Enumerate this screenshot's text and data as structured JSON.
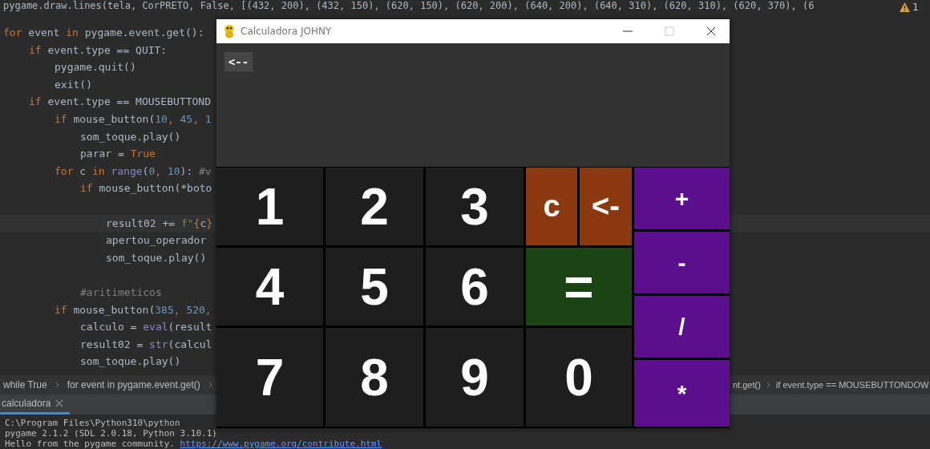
{
  "editor": {
    "top_line": "pygame.draw.lines(tela, CorPRETO, False, [(432, 200), (432, 150), (620, 150), (620, 200), (640, 200), (640, 310), (620, 310), (620, 370), (6",
    "warning_count": "1",
    "lines": [
      {
        "tokens": [
          {
            "text": "for ",
            "kind": "kw"
          },
          {
            "text": "event ",
            "kind": "plain"
          },
          {
            "text": "in ",
            "kind": "kw"
          },
          {
            "text": "pygame.event.get():",
            "kind": "plain"
          }
        ],
        "children": [
          {
            "tokens": [
              {
                "text": "if ",
                "kind": "kw"
              },
              {
                "text": "event.type == QUIT:",
                "kind": "plain"
              }
            ],
            "children": [
              {
                "tokens": [
                  {
                    "text": "pygame.quit()",
                    "kind": "plain"
                  }
                ]
              },
              {
                "tokens": [
                  {
                    "text": "exit()",
                    "kind": "plain"
                  }
                ]
              }
            ]
          },
          {
            "tokens": [
              {
                "text": "if ",
                "kind": "kw"
              },
              {
                "text": "event.type == MOUSEBUTTOND",
                "kind": "plain"
              }
            ],
            "children": [
              {
                "tokens": [
                  {
                    "text": "if ",
                    "kind": "kw"
                  },
                  {
                    "text": "mouse_button(",
                    "kind": "plain"
                  },
                  {
                    "text": "10",
                    "kind": "num"
                  },
                  {
                    "text": ", ",
                    "kind": "kw"
                  },
                  {
                    "text": "45",
                    "kind": "num"
                  },
                  {
                    "text": ", ",
                    "kind": "kw"
                  },
                  {
                    "text": "1",
                    "kind": "num"
                  }
                ],
                "children": [
                  {
                    "tokens": [
                      {
                        "text": "som_toque.play()",
                        "kind": "plain"
                      }
                    ]
                  },
                  {
                    "tokens": [
                      {
                        "text": "parar = ",
                        "kind": "plain"
                      },
                      {
                        "text": "True",
                        "kind": "kw"
                      }
                    ]
                  }
                ]
              },
              {
                "tokens": [
                  {
                    "text": "for ",
                    "kind": "kw"
                  },
                  {
                    "text": "c ",
                    "kind": "plain"
                  },
                  {
                    "text": "in ",
                    "kind": "kw"
                  },
                  {
                    "text": "range",
                    "kind": "builtin"
                  },
                  {
                    "text": "(",
                    "kind": "plain"
                  },
                  {
                    "text": "0",
                    "kind": "num"
                  },
                  {
                    "text": ", ",
                    "kind": "kw"
                  },
                  {
                    "text": "10",
                    "kind": "num"
                  },
                  {
                    "text": "): ",
                    "kind": "plain"
                  },
                  {
                    "text": "#v",
                    "kind": "comment"
                  }
                ],
                "children": [
                  {
                    "tokens": [
                      {
                        "text": "if ",
                        "kind": "kw"
                      },
                      {
                        "text": "mouse_button(*boto",
                        "kind": "plain"
                      }
                    ],
                    "children": [
                      {
                        "blank_before": true,
                        "highlighted": true,
                        "tokens": [
                          {
                            "text": "result02 += ",
                            "kind": "plain"
                          },
                          {
                            "text": "f\"",
                            "kind": "str"
                          },
                          {
                            "text": "{",
                            "kind": "kw"
                          },
                          {
                            "text": "c",
                            "kind": "plain"
                          },
                          {
                            "text": "}",
                            "kind": "kw"
                          }
                        ]
                      },
                      {
                        "tokens": [
                          {
                            "text": "apertou_operador",
                            "kind": "plain"
                          }
                        ]
                      },
                      {
                        "tokens": [
                          {
                            "text": "som_toque.play()",
                            "kind": "plain"
                          }
                        ]
                      }
                    ]
                  },
                  {
                    "blank_before": true,
                    "tokens": [
                      {
                        "text": "#aritimeticos",
                        "kind": "comment"
                      }
                    ]
                  }
                ]
              },
              {
                "tokens": [
                  {
                    "text": "if ",
                    "kind": "kw"
                  },
                  {
                    "text": "mouse_button(",
                    "kind": "plain"
                  },
                  {
                    "text": "385",
                    "kind": "num"
                  },
                  {
                    "text": ", ",
                    "kind": "kw"
                  },
                  {
                    "text": "520",
                    "kind": "num"
                  },
                  {
                    "text": ",",
                    "kind": "kw"
                  }
                ],
                "children": [
                  {
                    "tokens": [
                      {
                        "text": "calculo = ",
                        "kind": "plain"
                      },
                      {
                        "text": "eval",
                        "kind": "builtin"
                      },
                      {
                        "text": "(result",
                        "kind": "plain"
                      }
                    ]
                  },
                  {
                    "tokens": [
                      {
                        "text": "result02 = ",
                        "kind": "plain"
                      },
                      {
                        "text": "str",
                        "kind": "builtin"
                      },
                      {
                        "text": "(calcul",
                        "kind": "plain"
                      }
                    ]
                  },
                  {
                    "tokens": [
                      {
                        "text": "som_toque.play()",
                        "kind": "plain"
                      }
                    ]
                  }
                ]
              }
            ]
          }
        ]
      }
    ]
  },
  "breadcrumbs_left": [
    "while True",
    "for event in pygame.event.get()"
  ],
  "breadcrumbs_right": [
    "nt.get()",
    "if event.type == MOUSEBUTTONDOW"
  ],
  "run_tab": {
    "label": "calculadora"
  },
  "terminal": {
    "lines": [
      "C:\\Program Files\\Python310\\python",
      "pygame 2.1.2 (SDL 2.0.18, Python 3.10.1)"
    ],
    "last_text": "Hello from the pygame community.",
    "last_link": "https://www.pygame.org/contribute.html"
  },
  "calculator": {
    "title": "Calculadora JOHNY",
    "back_label": "<--",
    "keys": [
      {
        "label": "1",
        "kind": "digit",
        "wide": false
      },
      {
        "label": "2",
        "kind": "digit",
        "wide": false
      },
      {
        "label": "3",
        "kind": "digit",
        "wide": false
      },
      {
        "label": "c",
        "kind": "clear",
        "wide": false
      },
      {
        "label": "<-",
        "kind": "clear",
        "wide": false
      },
      {
        "label": "4",
        "kind": "digit",
        "wide": false
      },
      {
        "label": "5",
        "kind": "digit",
        "wide": false
      },
      {
        "label": "6",
        "kind": "digit",
        "wide": false
      },
      {
        "label": "=",
        "kind": "equals",
        "wide": true
      },
      {
        "label": "7",
        "kind": "digit",
        "wide": false
      },
      {
        "label": "8",
        "kind": "digit",
        "wide": false
      },
      {
        "label": "9",
        "kind": "digit",
        "wide": false
      },
      {
        "label": "0",
        "kind": "digit",
        "wide": true
      }
    ],
    "operators": [
      "+",
      "-",
      "/",
      "*"
    ]
  }
}
